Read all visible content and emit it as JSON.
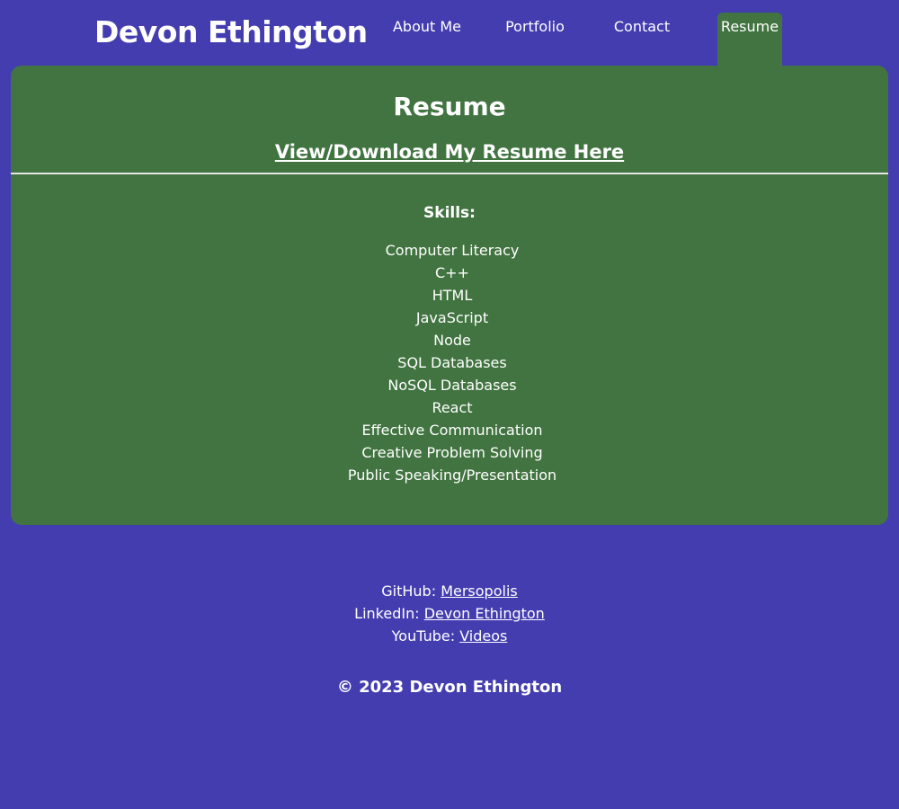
{
  "header": {
    "site_title": "Devon Ethington",
    "nav": {
      "about": "About Me",
      "portfolio": "Portfolio",
      "contact": "Contact",
      "resume": "Resume"
    }
  },
  "main": {
    "title": "Resume",
    "resume_link": "View/Download My Resume Here",
    "skills_heading": "Skills:",
    "skills": [
      "Computer Literacy",
      "C++",
      "HTML",
      "JavaScript",
      "Node",
      "SQL Databases",
      "NoSQL Databases",
      "React",
      "Effective Communication",
      "Creative Problem Solving",
      "Public Speaking/Presentation"
    ]
  },
  "footer": {
    "github_label": "GitHub:",
    "github_link": "Mersopolis",
    "linkedin_label": "LinkedIn:",
    "linkedin_link": "Devon Ethington",
    "youtube_label": "YouTube:",
    "youtube_link": "Videos",
    "copyright": "© 2023 Devon Ethington"
  },
  "colors": {
    "page_background": "#443db0",
    "panel_green": "#417440",
    "text": "#ffffff"
  }
}
